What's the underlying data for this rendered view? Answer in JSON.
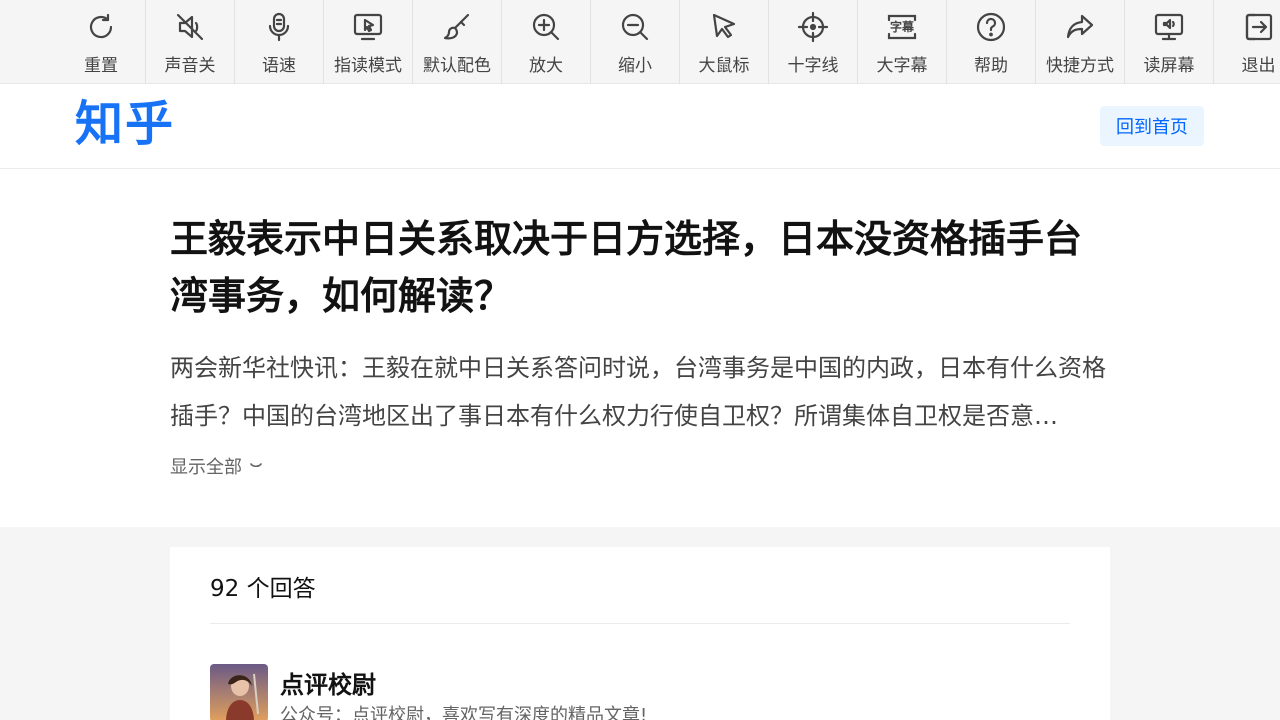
{
  "toolbar": {
    "items": [
      {
        "label": "重置",
        "icon": "reset-icon"
      },
      {
        "label": "声音关",
        "icon": "sound-off-icon"
      },
      {
        "label": "语速",
        "icon": "speech-rate-icon"
      },
      {
        "label": "指读模式",
        "icon": "point-read-icon"
      },
      {
        "label": "默认配色",
        "icon": "color-brush-icon"
      },
      {
        "label": "放大",
        "icon": "zoom-in-icon"
      },
      {
        "label": "缩小",
        "icon": "zoom-out-icon"
      },
      {
        "label": "大鼠标",
        "icon": "big-cursor-icon"
      },
      {
        "label": "十字线",
        "icon": "crosshair-icon"
      },
      {
        "label": "大字幕",
        "icon": "captions-icon"
      },
      {
        "label": "帮助",
        "icon": "help-icon"
      },
      {
        "label": "快捷方式",
        "icon": "shortcut-icon"
      },
      {
        "label": "读屏幕",
        "icon": "screen-reader-icon"
      },
      {
        "label": "退出",
        "icon": "exit-icon"
      }
    ],
    "caption_icon_text": "字幕"
  },
  "header": {
    "logo": "知乎",
    "home_button": "回到首页"
  },
  "question": {
    "title": "王毅表示中日关系取决于日方选择，日本没资格插手台湾事务，如何解读？",
    "detail": "两会新华社快讯：王毅在就中日关系答问时说，台湾事务是中国的内政，日本有什么资格插手？中国的台湾地区出了事日本有什么权力行使自卫权？所谓集体自卫权是否意…",
    "show_all": "显示全部"
  },
  "answers": {
    "count_label": "92 个回答",
    "first": {
      "author": "点评校尉",
      "bio": "公众号：点评校尉，喜欢写有深度的精品文章!"
    }
  },
  "colors": {
    "brand": "#1772f6",
    "home_button_bg": "#ebf5ff",
    "home_button_text": "#0066ff"
  }
}
